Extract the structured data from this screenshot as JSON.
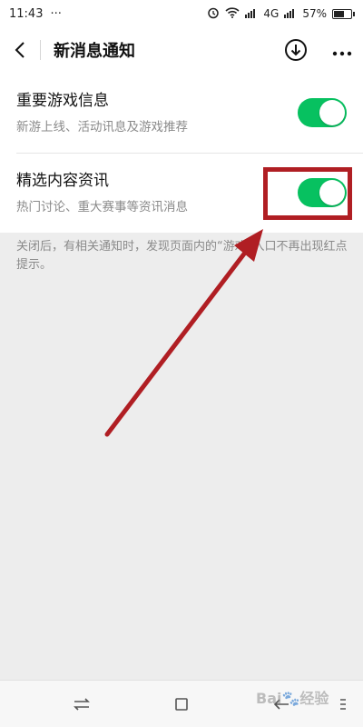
{
  "status_bar": {
    "time": "11:43",
    "dots": "···",
    "network": "4G",
    "battery": "57%"
  },
  "nav": {
    "title": "新消息通知"
  },
  "settings": [
    {
      "title": "重要游戏信息",
      "desc": "新游上线、活动讯息及游戏推荐",
      "enabled": true
    },
    {
      "title": "精选内容资讯",
      "desc": "热门讨论、重大赛事等资讯消息",
      "enabled": true
    }
  ],
  "footer_note": "关闭后，有相关通知时，发现页面内的“游戏”入口不再出现红点提示。",
  "watermark": "Bai🐾经验",
  "colors": {
    "toggle_on": "#07c160",
    "annotation_red": "#b01e23"
  }
}
